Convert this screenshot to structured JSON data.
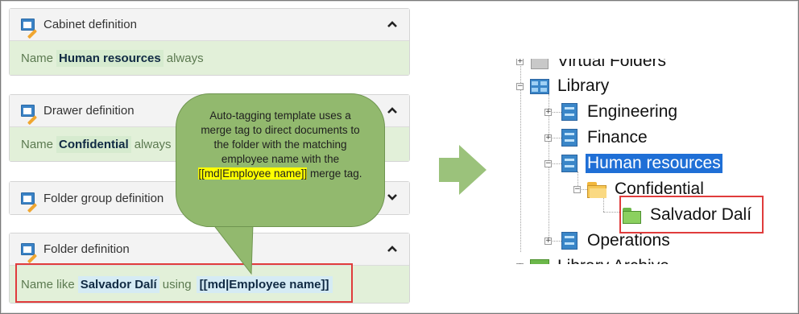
{
  "panels": [
    {
      "title": "Cabinet definition",
      "label": "Name",
      "value": "Human resources",
      "suffix": "always",
      "chevron": "up"
    },
    {
      "title": "Drawer definition",
      "label": "Name",
      "value": "Confidential",
      "suffix": "always",
      "chevron": "up"
    },
    {
      "title": "Folder group definition",
      "chevron": "down"
    },
    {
      "title": "Folder definition",
      "label": "Name like",
      "value": "Salvador Dalí",
      "suffix": "using",
      "tag": "[[md|Employee name]]",
      "chevron": "up"
    }
  ],
  "callout": {
    "text_before": "Auto-tagging template uses a merge tag to direct documents to the folder with the matching employee name with the",
    "highlight": "[[md|Employee name]]",
    "text_after": "merge tag.",
    "fill_color": "#92b96e",
    "highlight_color": "#ffff00"
  },
  "tree": {
    "nodes": [
      {
        "label": "Virtual Folders",
        "icon": "virtual-folder-icon"
      },
      {
        "label": "Library",
        "icon": "cabinet-icon"
      },
      {
        "label": "Engineering",
        "icon": "drawer-icon"
      },
      {
        "label": "Finance",
        "icon": "drawer-icon"
      },
      {
        "label": "Human resources",
        "icon": "drawer-icon",
        "selected": true
      },
      {
        "label": "Confidential",
        "icon": "folder-open-icon"
      },
      {
        "label": "Salvador Dalí",
        "icon": "folder-green-icon"
      },
      {
        "label": "Operations",
        "icon": "drawer-icon"
      },
      {
        "label": "Library Archive",
        "icon": "cabinet-green-icon"
      }
    ]
  },
  "colors": {
    "accent": "#1f6fd6",
    "highlight_box": "#e03c3c",
    "panel_body": "#e2f0d9",
    "arrow": "#9bc27b"
  }
}
